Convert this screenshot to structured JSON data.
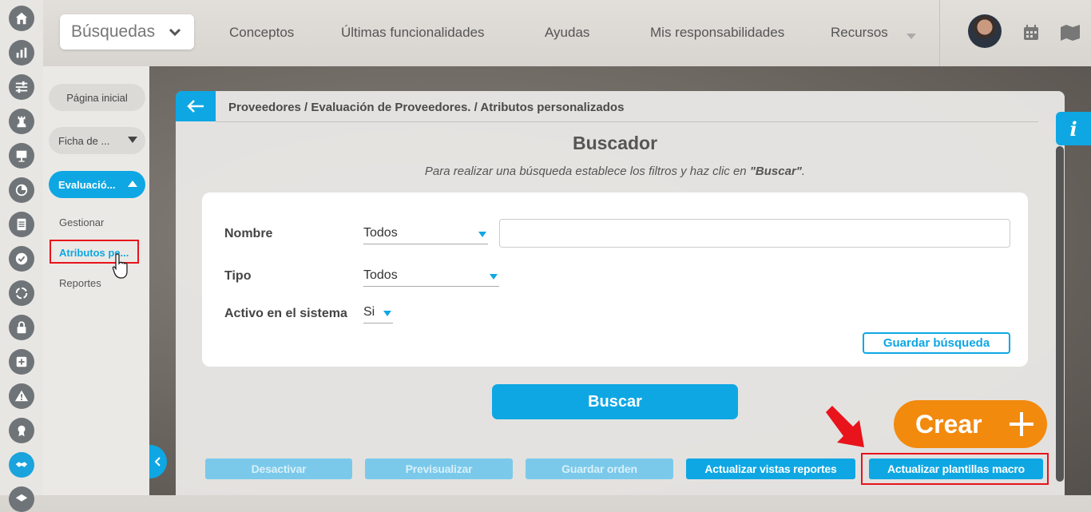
{
  "header": {
    "search_label": "Búsquedas",
    "nav": [
      "Conceptos",
      "Últimas funcionalidades",
      "Ayudas",
      "Mis responsabilidades",
      "Recursos"
    ]
  },
  "rail_icons": [
    "home-icon",
    "bar-chart-icon",
    "sliders-icon",
    "chess-rook-icon",
    "presentation-icon",
    "pie-chart-icon",
    "document-icon",
    "check-circle-icon",
    "cycle-icon",
    "lock-icon",
    "plus-square-icon",
    "warning-icon",
    "award-icon",
    "handshake-icon",
    "layers-icon"
  ],
  "sidebar": {
    "home": "Página inicial",
    "ficha": "Ficha de ...",
    "evaluacion": "Evaluació...",
    "sub_items": [
      "Gestionar",
      "Atributos pe...",
      "Reportes"
    ]
  },
  "breadcrumb": "Proveedores / Evaluación de Proveedores. / Atributos personalizados",
  "title": "Buscador",
  "subtitle": {
    "before": "Para realizar una búsqueda establece los filtros y haz clic en ",
    "bold": "\"Buscar\"",
    "after": "."
  },
  "filters": {
    "nombre_label": "Nombre",
    "nombre_value": "Todos",
    "tipo_label": "Tipo",
    "tipo_value": "Todos",
    "activo_label": "Activo en el sistema",
    "activo_value": "Si",
    "save_search": "Guardar búsqueda"
  },
  "buscar": "Buscar",
  "actions": {
    "desactivar": "Desactivar",
    "previsualizar": "Previsualizar",
    "guardar_orden": "Guardar orden",
    "actualizar_vistas": "Actualizar vistas reportes",
    "actualizar_plantillas": "Actualizar plantillas macro"
  },
  "crear": "Crear",
  "info": "i",
  "colors": {
    "accent": "#0ea7e3",
    "crear": "#f28a0e",
    "highlight": "#e8131b"
  }
}
